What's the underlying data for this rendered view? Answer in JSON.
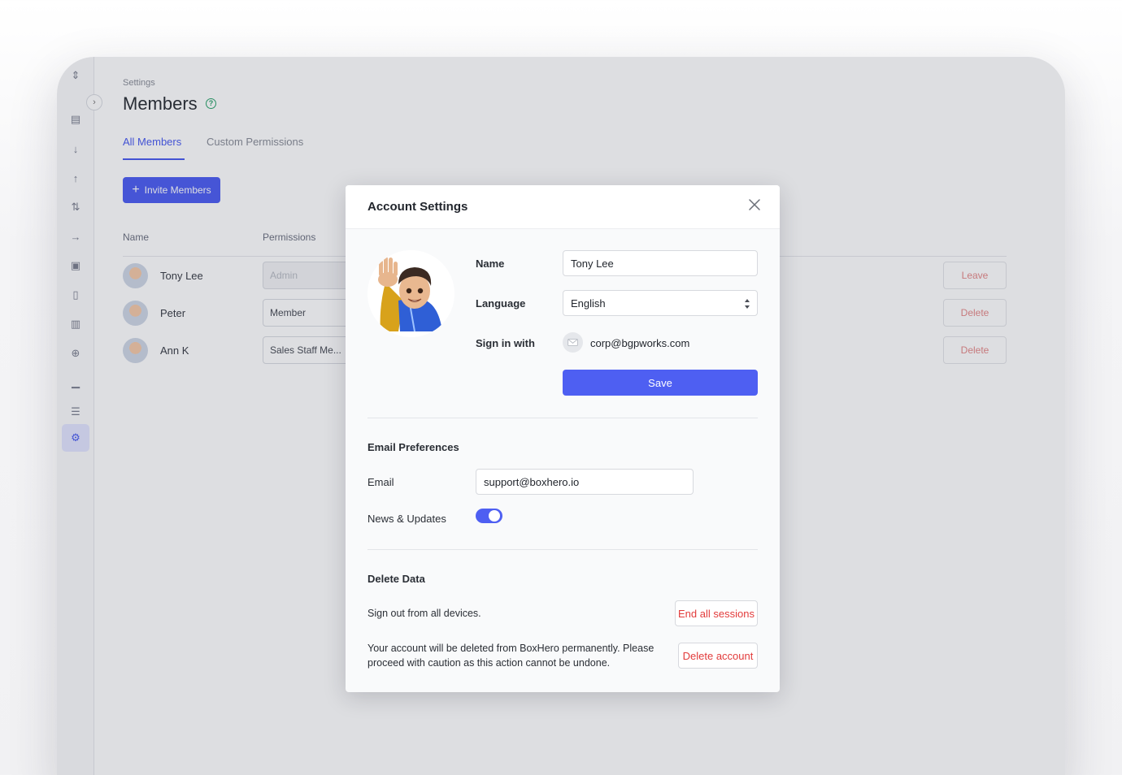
{
  "background": {
    "breadcrumb": "Settings",
    "page_title": "Members",
    "tabs": [
      {
        "label": "All Members"
      },
      {
        "label": "Custom Permissions"
      }
    ],
    "invite_button": "Invite Members",
    "columns": [
      "Name",
      "Permissions"
    ],
    "members": [
      {
        "name": "Tony Lee",
        "permission": "Admin",
        "action": "Leave"
      },
      {
        "name": "Peter",
        "permission": "Member",
        "action": "Delete"
      },
      {
        "name": "Ann K",
        "permission": "Sales Staff Me...",
        "action": "Delete"
      }
    ]
  },
  "modal": {
    "title": "Account Settings",
    "profile": {
      "name_label": "Name",
      "name_value": "Tony Lee",
      "language_label": "Language",
      "language_value": "English",
      "signin_label": "Sign in with",
      "signin_email": "corp@bgpworks.com",
      "save_label": "Save"
    },
    "email_preferences": {
      "heading": "Email Preferences",
      "email_label": "Email",
      "email_value": "support@boxhero.io",
      "news_label": "News & Updates",
      "news_enabled": true
    },
    "delete_data": {
      "heading": "Delete Data",
      "sessions_text": "Sign out from all devices.",
      "sessions_button": "End all sessions",
      "account_text": "Your account will be deleted from BoxHero permanently. Please proceed with caution as this action cannot be undone.",
      "account_button": "Delete account"
    }
  },
  "colors": {
    "accent": "#4e5ff2",
    "danger": "#e23b3b"
  }
}
